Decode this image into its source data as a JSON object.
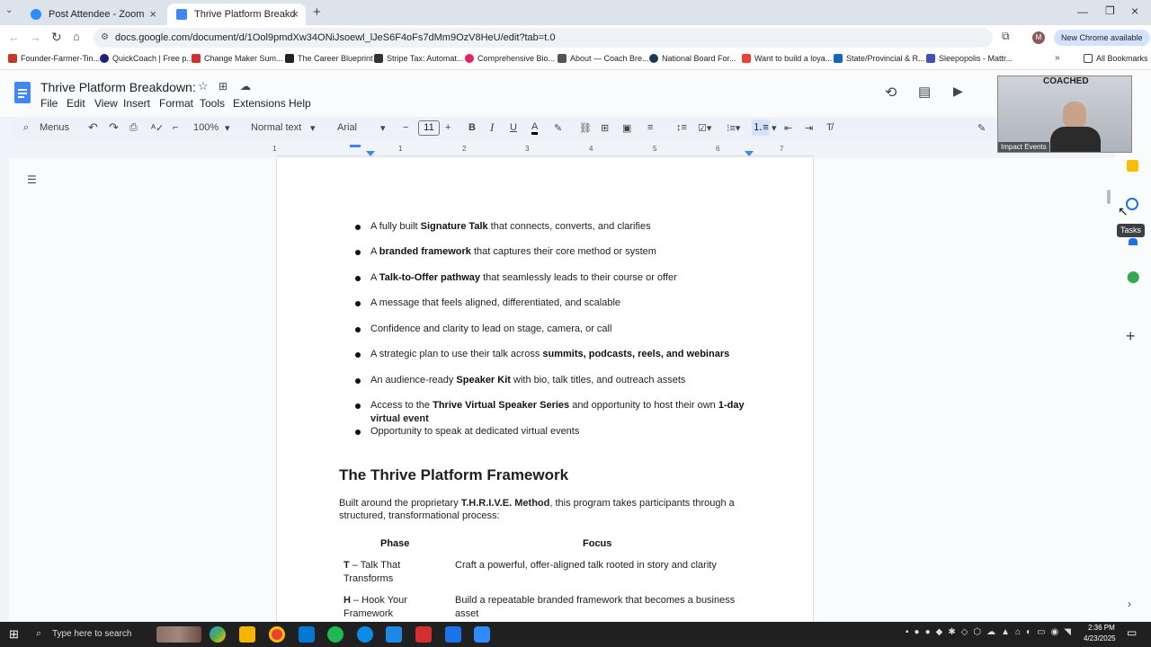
{
  "tabs": [
    {
      "label": "Post Attendee - Zoom",
      "color": "#2d8cff"
    },
    {
      "label": "Thrive Platform Breakdown: - G",
      "color": "#4285f4"
    }
  ],
  "address": "docs.google.com/document/d/1Ool9pmdXw34ONiJsoewl_lJeS6F4oFs7dMm9OzV8HeU/edit?tab=t.0",
  "chrome_available": "New Chrome available",
  "bookmarks": [
    "Founder-Farmer-Tin...",
    "QuickCoach | Free p...",
    "Change Maker Sum...",
    "The Career Blueprint",
    "Stripe Tax: Automat...",
    "Comprehensive Bio...",
    "About — Coach Bre...",
    "National Board For...",
    "Want to build a loya...",
    "State/Provincial & R...",
    "Sleepopolis - Mattr...",
    "All Bookmarks"
  ],
  "doc": {
    "title": "Thrive Platform Breakdown:",
    "menus": [
      "File",
      "Edit",
      "View",
      "Insert",
      "Format",
      "Tools",
      "Extensions",
      "Help"
    ],
    "toolbar": {
      "menus": "Menus",
      "zoom": "100%",
      "style": "Normal text",
      "font": "Arial",
      "size": "11"
    },
    "ruler": [
      "1",
      "1",
      "2",
      "3",
      "4",
      "5",
      "6",
      "7"
    ]
  },
  "bullets": [
    {
      "pre": "A fully built ",
      "bold": "Signature Talk",
      "post": " that connects, converts, and clarifies"
    },
    {
      "pre": "A ",
      "bold": "branded framework",
      "post": " that captures their core method or system"
    },
    {
      "pre": "A ",
      "bold": "Talk-to-Offer pathway",
      "post": " that seamlessly leads to their course or offer"
    },
    {
      "pre": "A message that feels aligned, differentiated, and scalable",
      "bold": "",
      "post": ""
    },
    {
      "pre": "Confidence and clarity to lead on stage, camera, or call",
      "bold": "",
      "post": ""
    },
    {
      "pre": "A strategic plan to use their talk across ",
      "bold": "summits, podcasts, reels, and webinars",
      "post": ""
    },
    {
      "pre": "An audience-ready ",
      "bold": "Speaker Kit",
      "post": " with bio, talk titles, and outreach assets"
    },
    {
      "pre": "Access to the ",
      "bold": "Thrive Virtual Speaker Series",
      "post": " and opportunity to host their own ",
      "bold2": "1-day",
      "line2": "virtual event"
    },
    {
      "pre": "Opportunity to speak at dedicated virtual events",
      "bold": "",
      "post": ""
    }
  ],
  "heading": "The Thrive Platform Framework",
  "intro": {
    "pre": "Built around the proprietary ",
    "bold": "T.H.R.I.V.E. Method",
    "post": ", this program takes participants through a",
    "line2": "structured, transformational process:"
  },
  "table": {
    "headers": [
      "Phase",
      "Focus"
    ],
    "rows": [
      {
        "letter": "T",
        "phase1": " – Talk That",
        "phase2": "Transforms",
        "focus1": "Craft a powerful, offer-aligned talk rooted in story and clarity",
        "focus2": ""
      },
      {
        "letter": "H",
        "phase1": " – Hook Your",
        "phase2": "Framework",
        "focus1": "Build a repeatable branded framework that becomes a business",
        "focus2": "asset"
      }
    ]
  },
  "zoom_overlay": {
    "label": "Impact Events",
    "banner": "COACHED"
  },
  "tooltip": "Tasks",
  "taskbar": {
    "search": "Type here to search",
    "time": "2:36 PM",
    "date": "4/23/2025"
  }
}
